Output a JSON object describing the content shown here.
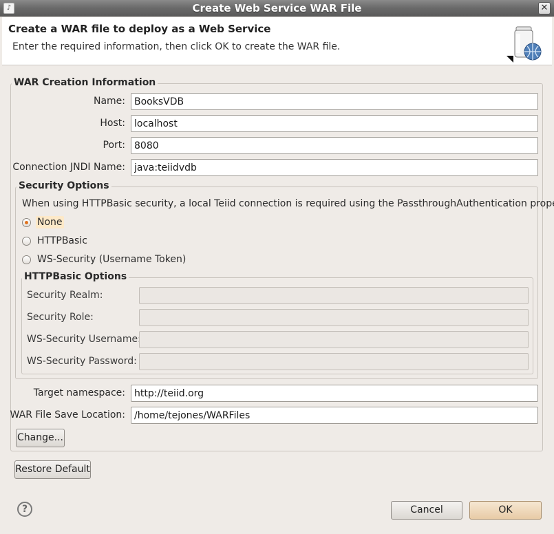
{
  "window": {
    "title": "Create Web Service WAR File",
    "icon": "app-icon",
    "close_glyph": "✕"
  },
  "banner": {
    "title": "Create a WAR file to deploy as a Web Service",
    "message": "Enter the required information, then click OK to create the WAR file.",
    "icon": "database-globe-icon"
  },
  "war_info": {
    "group_label": "WAR Creation Information",
    "name_label": "Name:",
    "name_value": "BooksVDB",
    "host_label": "Host:",
    "host_value": "localhost",
    "port_label": "Port:",
    "port_value": "8080",
    "jndi_label": "Connection JNDI Name:",
    "jndi_value": "java:teiidvdb"
  },
  "security": {
    "group_label": "Security Options",
    "description": "When using HTTPBasic security, a local Teiid connection is required using the PassthroughAuthentication property.",
    "options": [
      "None",
      "HTTPBasic",
      "WS-Security (Username Token)"
    ],
    "selected": "None"
  },
  "httpbasic": {
    "group_label": "HTTPBasic Options",
    "realm_label": "Security Realm:",
    "realm_value": "",
    "role_label": "Security Role:",
    "role_value": "",
    "ws_user_label": "WS-Security Username:",
    "ws_user_value": "",
    "ws_pass_label": "WS-Security Password:",
    "ws_pass_value": ""
  },
  "target": {
    "namespace_label": "Target namespace:",
    "namespace_value": "http://teiid.org",
    "location_label": "WAR File Save Location:",
    "location_value": "/home/tejones/WARFiles",
    "change_label": "Change..."
  },
  "buttons": {
    "restore_default": "Restore Default",
    "cancel": "Cancel",
    "ok": "OK",
    "help_glyph": "?"
  },
  "colors": {
    "accent": "#e0731f",
    "dialog_bg": "#efebe7",
    "titlebar": "#6a6a6a"
  }
}
